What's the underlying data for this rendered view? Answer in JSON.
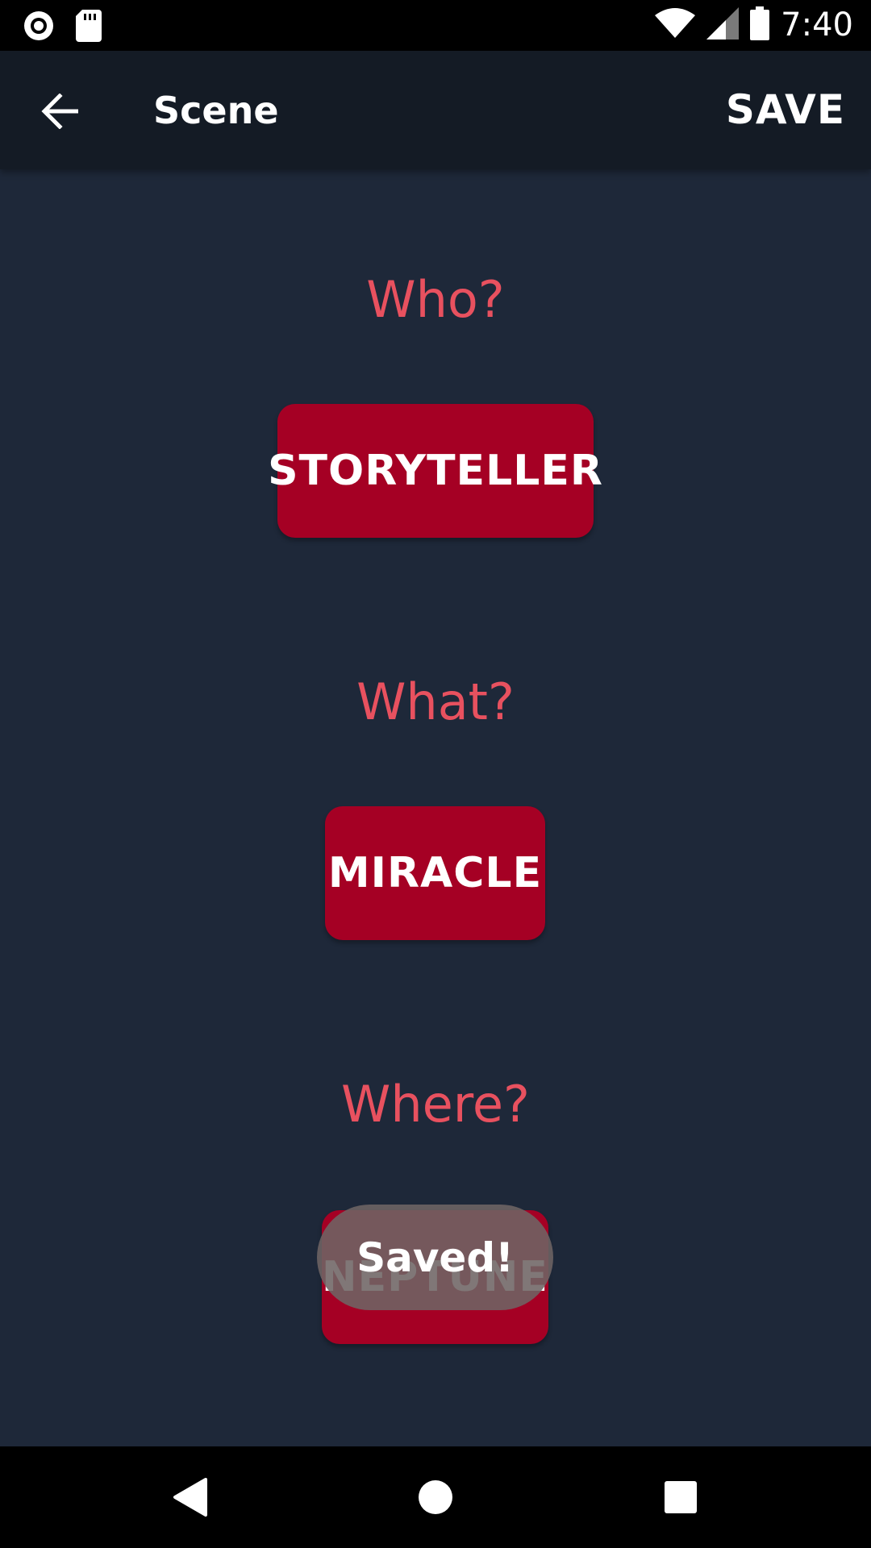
{
  "status_bar": {
    "time": "7:40",
    "icons": [
      "record-icon",
      "sd-card-icon",
      "wifi-icon",
      "signal-icon",
      "battery-icon"
    ]
  },
  "app_bar": {
    "title": "Scene",
    "save_label": "SAVE",
    "back_icon": "arrow-left-icon"
  },
  "sections": [
    {
      "question": "Who?",
      "answer": "STORYTELLER"
    },
    {
      "question": "What?",
      "answer": "MIRACLE"
    },
    {
      "question": "Where?",
      "answer": "NEPTUNE"
    }
  ],
  "toast": {
    "message": "Saved!"
  },
  "nav_bar": {
    "icons": [
      "back-triangle-icon",
      "home-circle-icon",
      "recents-square-icon"
    ]
  },
  "colors": {
    "background": "#1e2839",
    "app_bar": "#141b25",
    "accent_text": "#e8515f",
    "button": "#a50024"
  }
}
